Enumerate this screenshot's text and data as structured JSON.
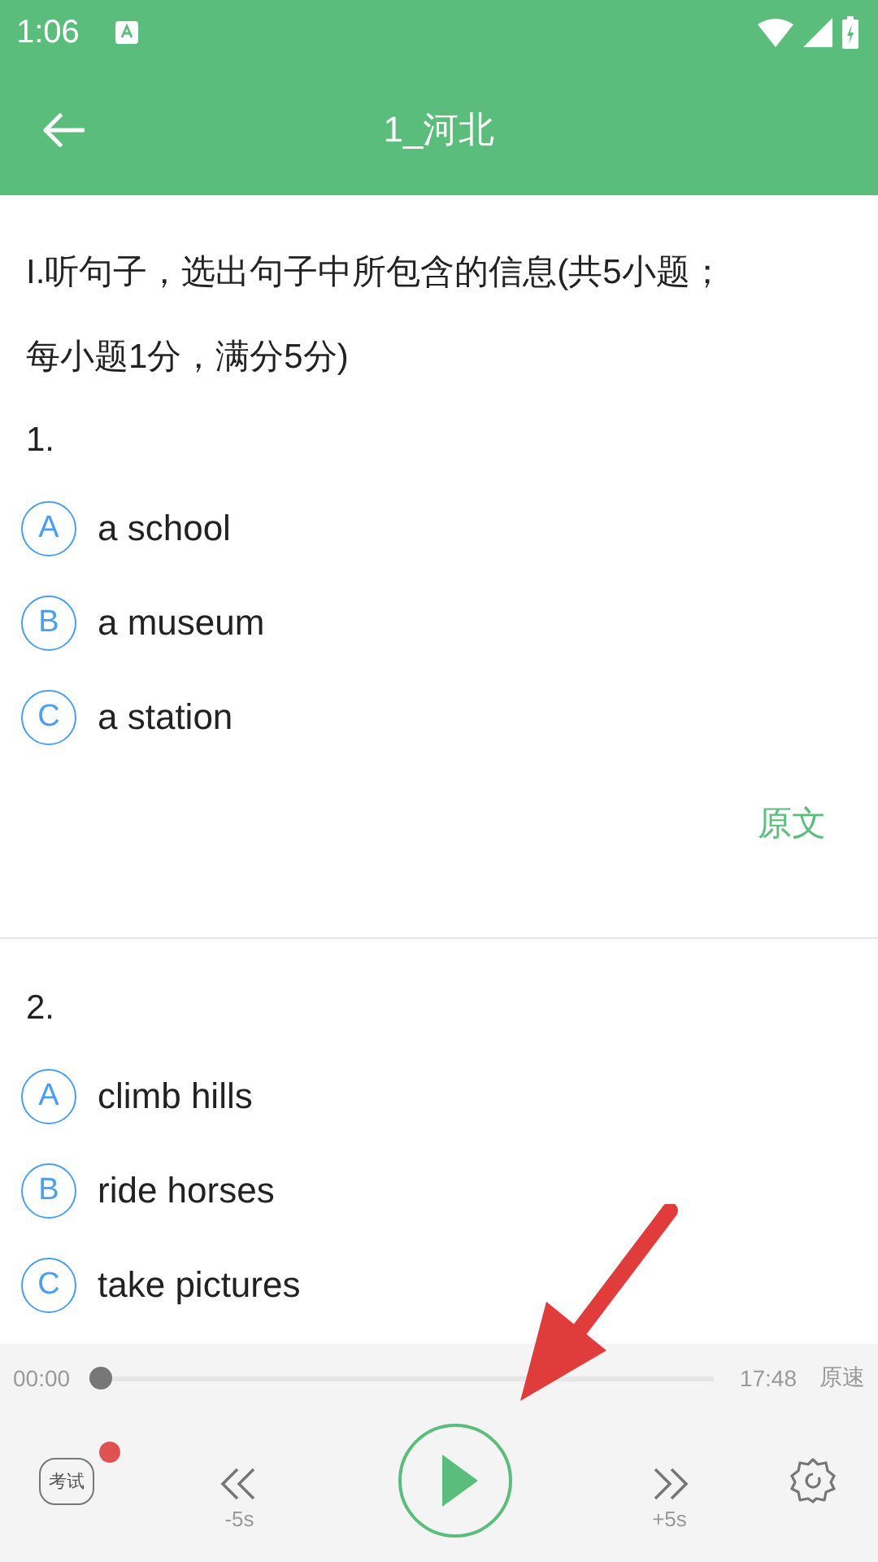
{
  "status_bar": {
    "time": "1:06"
  },
  "app_bar": {
    "title": "1_河北"
  },
  "section": {
    "instruction": "I.听句子，选出句子中所包含的信息(共5小题；每小题1分，满分5分)"
  },
  "questions": [
    {
      "number": "1.",
      "options": [
        {
          "letter": "A",
          "text": "a school"
        },
        {
          "letter": "B",
          "text": "a museum"
        },
        {
          "letter": "C",
          "text": "a station"
        }
      ],
      "source_link": "原文"
    },
    {
      "number": "2.",
      "options": [
        {
          "letter": "A",
          "text": "climb hills"
        },
        {
          "letter": "B",
          "text": "ride horses"
        },
        {
          "letter": "C",
          "text": "take pictures"
        }
      ]
    }
  ],
  "player": {
    "elapsed": "00:00",
    "level": 0,
    "total": "17:48",
    "speed": "原速",
    "exam_label": "考试",
    "exam_badge": true,
    "rewind": "-5s",
    "forward": "+5s"
  }
}
